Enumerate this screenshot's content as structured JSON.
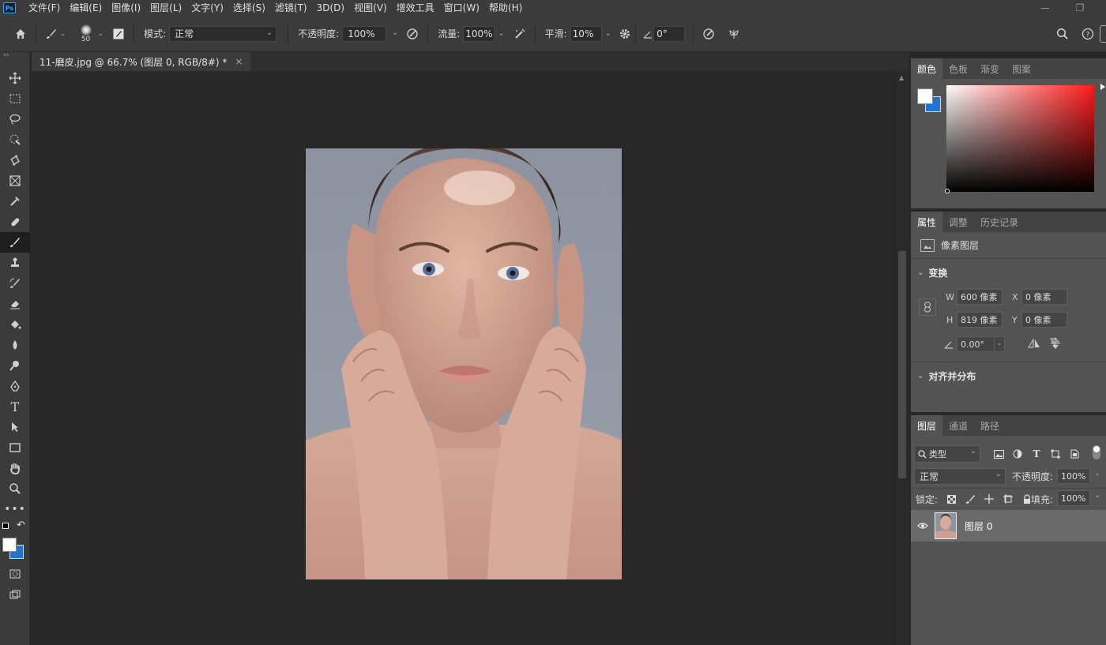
{
  "menubar": {
    "logo": "Ps",
    "items": [
      "文件(F)",
      "编辑(E)",
      "图像(I)",
      "图层(L)",
      "文字(Y)",
      "选择(S)",
      "滤镜(T)",
      "3D(D)",
      "视图(V)",
      "增效工具",
      "窗口(W)",
      "帮助(H)"
    ],
    "minimize": "—",
    "restore": "❐"
  },
  "options": {
    "brush_size": "50",
    "mode_label": "模式:",
    "mode_value": "正常",
    "opacity_label": "不透明度:",
    "opacity_value": "100%",
    "flow_label": "流量:",
    "flow_value": "100%",
    "smooth_label": "平滑:",
    "smooth_value": "10%",
    "angle_value": "0°"
  },
  "document": {
    "tab_title": "11-磨皮.jpg @ 66.7% (图层 0, RGB/8#) *",
    "close": "×"
  },
  "color_panel": {
    "tabs": [
      "颜色",
      "色板",
      "渐变",
      "图案"
    ],
    "foreground": "#ffffff",
    "background": "#1f74d6",
    "hue": "#ff1a1a"
  },
  "properties_panel": {
    "tabs": [
      "属性",
      "调整",
      "历史记录"
    ],
    "layer_type": "像素图层",
    "transform_title": "变换",
    "w_label": "W",
    "w_value": "600 像素",
    "h_label": "H",
    "h_value": "819 像素",
    "x_label": "X",
    "x_value": "0 像素",
    "y_label": "Y",
    "y_value": "0 像素",
    "angle_value": "0.00°",
    "align_title": "对齐并分布"
  },
  "layers_panel": {
    "tabs": [
      "图层",
      "通道",
      "路径"
    ],
    "filter_label": "类型",
    "blend_mode": "正常",
    "opacity_label": "不透明度:",
    "opacity_value": "100%",
    "lock_label": "锁定:",
    "fill_label": "填充:",
    "fill_value": "100%",
    "layers": [
      {
        "name": "图层 0",
        "visible": true
      }
    ]
  }
}
